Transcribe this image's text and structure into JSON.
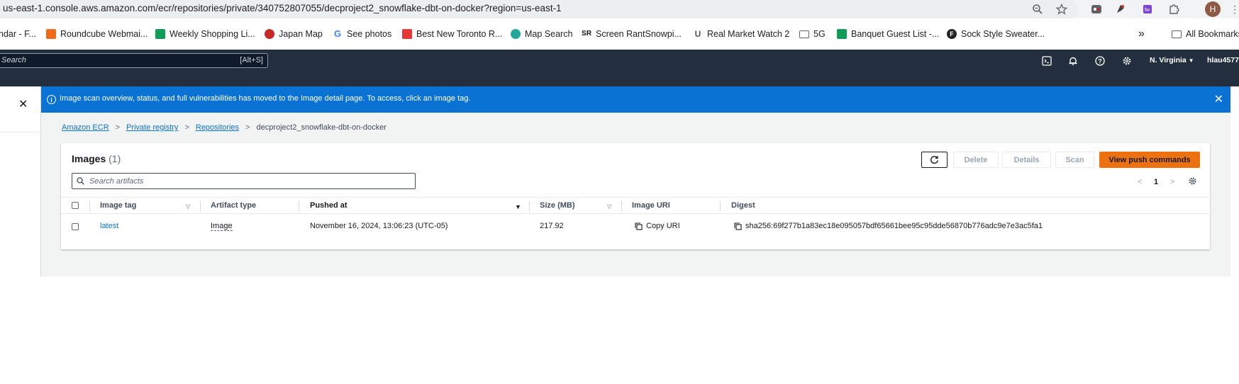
{
  "browser": {
    "url": "us-east-1.console.aws.amazon.com/ecr/repositories/private/340752807055/decproject2_snowflake-dbt-on-docker?region=us-east-1",
    "profile_initial": "H",
    "bookmarks": [
      {
        "label": "ndar - F...",
        "color": "#ffffff"
      },
      {
        "label": "Roundcube Webmai...",
        "color": "#f26b1d"
      },
      {
        "label": "Weekly Shopping Li...",
        "color": "#0f9d58"
      },
      {
        "label": "Japan Map",
        "color": "#c62828"
      },
      {
        "label": "See photos",
        "color": "#4285f4"
      },
      {
        "label": "Best New Toronto R...",
        "color": "#e53935"
      },
      {
        "label": "Map Search",
        "color": "#26a69a"
      },
      {
        "label": "Screen RantSnowpi...",
        "color": "#111111"
      },
      {
        "label": "Real Market Watch 2",
        "color": "#555555"
      },
      {
        "label": "5G",
        "color": "#555555"
      },
      {
        "label": "Banquet Guest List -...",
        "color": "#0f9d58"
      },
      {
        "label": "Sock Style Sweater...",
        "color": "#222222"
      }
    ],
    "bookmarks_overflow": "»",
    "all_bookmarks": "All Bookmarks"
  },
  "aws": {
    "search_placeholder": "Search",
    "search_shortcut": "[Alt+S]",
    "region": "N. Virginia",
    "user": "hlau4577"
  },
  "flash": {
    "message": "Image scan overview, status, and full vulnerabilities has moved to the Image detail page. To access, click an image tag."
  },
  "breadcrumb": {
    "items": [
      "Amazon ECR",
      "Private registry",
      "Repositories"
    ],
    "current": "decproject2_snowflake-dbt-on-docker"
  },
  "panel": {
    "title": "Images",
    "count": "(1)",
    "buttons": {
      "delete": "Delete",
      "details": "Details",
      "scan": "Scan",
      "push": "View push commands"
    },
    "search_placeholder": "Search artifacts",
    "page": "1"
  },
  "table": {
    "headers": {
      "tag": "Image tag",
      "artifact": "Artifact type",
      "pushed": "Pushed at",
      "size": "Size (MB)",
      "uri": "Image URI",
      "digest": "Digest"
    },
    "rows": [
      {
        "tag": "latest",
        "artifact": "Image",
        "pushed": "November 16, 2024, 13:06:23 (UTC-05)",
        "size": "217.92",
        "uri": "Copy URI",
        "digest": "sha256:69f277b1a83ec18e095057bdf65661bee95c95dde56870b776adc9e7e3ac5fa1"
      }
    ]
  }
}
